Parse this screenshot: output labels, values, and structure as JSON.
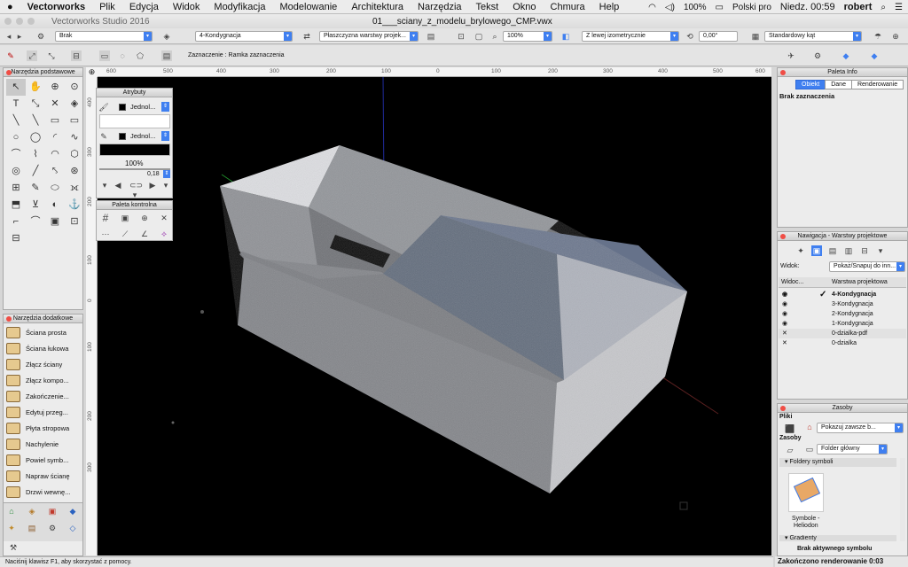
{
  "menubar": {
    "apple": "",
    "items": [
      "Vectorworks",
      "Plik",
      "Edycja",
      "Widok",
      "Modyfikacja",
      "Modelowanie",
      "Architektura",
      "Narzędzia",
      "Tekst",
      "Okno",
      "Chmura",
      "Help"
    ],
    "battery": "100%",
    "language": "Polski pro",
    "clock": "Niedz. 00:59",
    "user": "robert"
  },
  "window": {
    "app_title": "Vectorworks Studio 2016",
    "doc_title": "01___sciany_z_modelu_brylowego_CMP.vwx"
  },
  "toolbar1": {
    "class_select": "Brak",
    "layer_select": "4-Kondygnacja",
    "plane_select": "Płaszczyzna warstwy projek...",
    "zoom_select": "100%",
    "view_select": "Z lewej izometrycznie",
    "angle_field": "0,00°",
    "angle_mode_select": "Standardowy kąt"
  },
  "toolbar2": {
    "mode_label": "Zaznaczenie : Ramka zaznaczenia"
  },
  "ruler": {
    "h_ticks": [
      "600",
      "500",
      "400",
      "300",
      "200",
      "100",
      "0",
      "100",
      "200",
      "300",
      "400",
      "500",
      "600"
    ],
    "v_ticks": [
      "400",
      "300",
      "200",
      "100",
      "0",
      "100",
      "200",
      "300"
    ]
  },
  "basic_tools": {
    "title": "Narzędzia podstawowe",
    "icons": [
      "↖",
      "✋",
      "⊕",
      "⊙",
      "T",
      "⤡",
      "✕",
      "◈",
      "╲",
      "╲",
      "▭",
      "▭",
      "○",
      "◯",
      "◜",
      "∿",
      "⌒",
      "⌇",
      "◠",
      "⬡",
      "◎",
      "╱",
      "⤣",
      "⊛",
      "⊞",
      "✎",
      "⬭",
      "⟗",
      "⬒",
      "⊻",
      "◐",
      "⚓",
      "⌐",
      "⌒",
      "▣",
      "⊡",
      "⊟"
    ]
  },
  "attributes": {
    "title": "Atrybuty",
    "fill_label": "Jednol...",
    "pen_label": "Jednol...",
    "opacity": "100%",
    "line_weight": "0,18"
  },
  "control_palette": {
    "title": "Paleta kontrolna"
  },
  "extra_tools": {
    "title": "Narzędzia dodatkowe",
    "items": [
      "Ściana prosta",
      "Ściana łukowa",
      "Złącz ściany",
      "Złącz kompo...",
      "Zakończenie...",
      "Edytuj przeg...",
      "Płyta stropowa",
      "Nachylenie",
      "Powiel symb...",
      "Napraw ścianę",
      "Drzwi wewnę..."
    ]
  },
  "info_palette": {
    "title": "Paleta Info",
    "tabs": [
      "Obiekt",
      "Dane",
      "Renderowanie"
    ],
    "active_tab": "Obiekt",
    "selection": "Brak zaznaczenia"
  },
  "navigation": {
    "title": "Nawigacja - Warstwy projektowe",
    "view_label": "Widok:",
    "view_select": "Pokaż/Snapuj do inn...",
    "col_visibility": "Widoc...",
    "col_layer": "Warstwa projektowa",
    "layers": [
      {
        "name": "4-Kondygnacja",
        "vis": "eye",
        "active": true
      },
      {
        "name": "3-Kondygnacja",
        "vis": "eye",
        "active": false
      },
      {
        "name": "2-Kondygnacja",
        "vis": "eye",
        "active": false
      },
      {
        "name": "1-Kondygnacja",
        "vis": "eye",
        "active": false
      },
      {
        "name": "0-dzialka-pdf",
        "vis": "x",
        "active": false
      },
      {
        "name": "0-dzialka",
        "vis": "x",
        "active": false
      }
    ]
  },
  "resources": {
    "title": "Zasoby",
    "files_label": "Pliki",
    "files_select": "Pokazuj zawsze b...",
    "resources_label": "Zasoby",
    "folder_select": "Folder główny",
    "section_symbols": "Foldery symboli",
    "symbol_name_line1": "Symbole -",
    "symbol_name_line2": "Heliodon",
    "section_gradients": "Gradienty",
    "active_symbol": "Brak aktywnego symbolu"
  },
  "statusbar": {
    "hint": "Naciśnij klawisz F1, aby skorzystać z pomocy.",
    "render_status": "Zakończono renderowanie 0:03"
  },
  "colors": {
    "accent": "#3f7ff0",
    "canvas": "#000000",
    "close_dot": "#f04d45"
  }
}
